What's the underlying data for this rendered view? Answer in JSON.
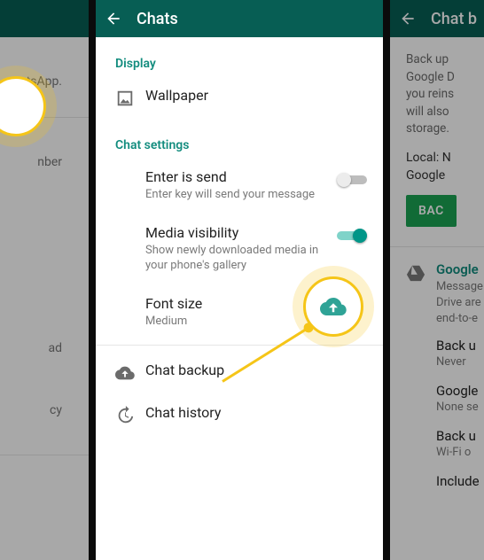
{
  "colors": {
    "header_bg": "#075E54",
    "accent": "#128C7E",
    "toggle_on": "#009688",
    "highlight": "#F5C518",
    "button_green": "#1BA352"
  },
  "panel_left": {
    "text1": "tsApp.",
    "text2": "nber",
    "text3": "ad",
    "text4": "cy"
  },
  "panel_mid": {
    "header": {
      "title": "Chats"
    },
    "section_display": "Display",
    "wallpaper": {
      "label": "Wallpaper"
    },
    "section_chat_settings": "Chat settings",
    "enter_is_send": {
      "title": "Enter is send",
      "subtitle": "Enter key will send your message",
      "on": false
    },
    "media_visibility": {
      "title": "Media visibility",
      "subtitle": "Show newly downloaded media in your phone's gallery",
      "on": true
    },
    "font_size": {
      "title": "Font size",
      "value": "Medium"
    },
    "chat_backup": {
      "label": "Chat backup"
    },
    "chat_history": {
      "label": "Chat history"
    }
  },
  "panel_right": {
    "header": {
      "title": "Chat b"
    },
    "intro": "Back up\nGoogle D\nyou reins\nwill also\nstorage.",
    "local_line": "Local: N",
    "google_line": "Google",
    "button": "BAC",
    "gdrive_heading": "Google",
    "gdrive_sub": "Message\nDrive are\nend-to-e",
    "backup_to": {
      "label": "Back u",
      "value": "Never"
    },
    "account": {
      "label": "Google",
      "value": "None se"
    },
    "backup_over": {
      "label": "Back u",
      "value": "Wi-Fi o"
    },
    "include": {
      "label": "Include"
    }
  }
}
